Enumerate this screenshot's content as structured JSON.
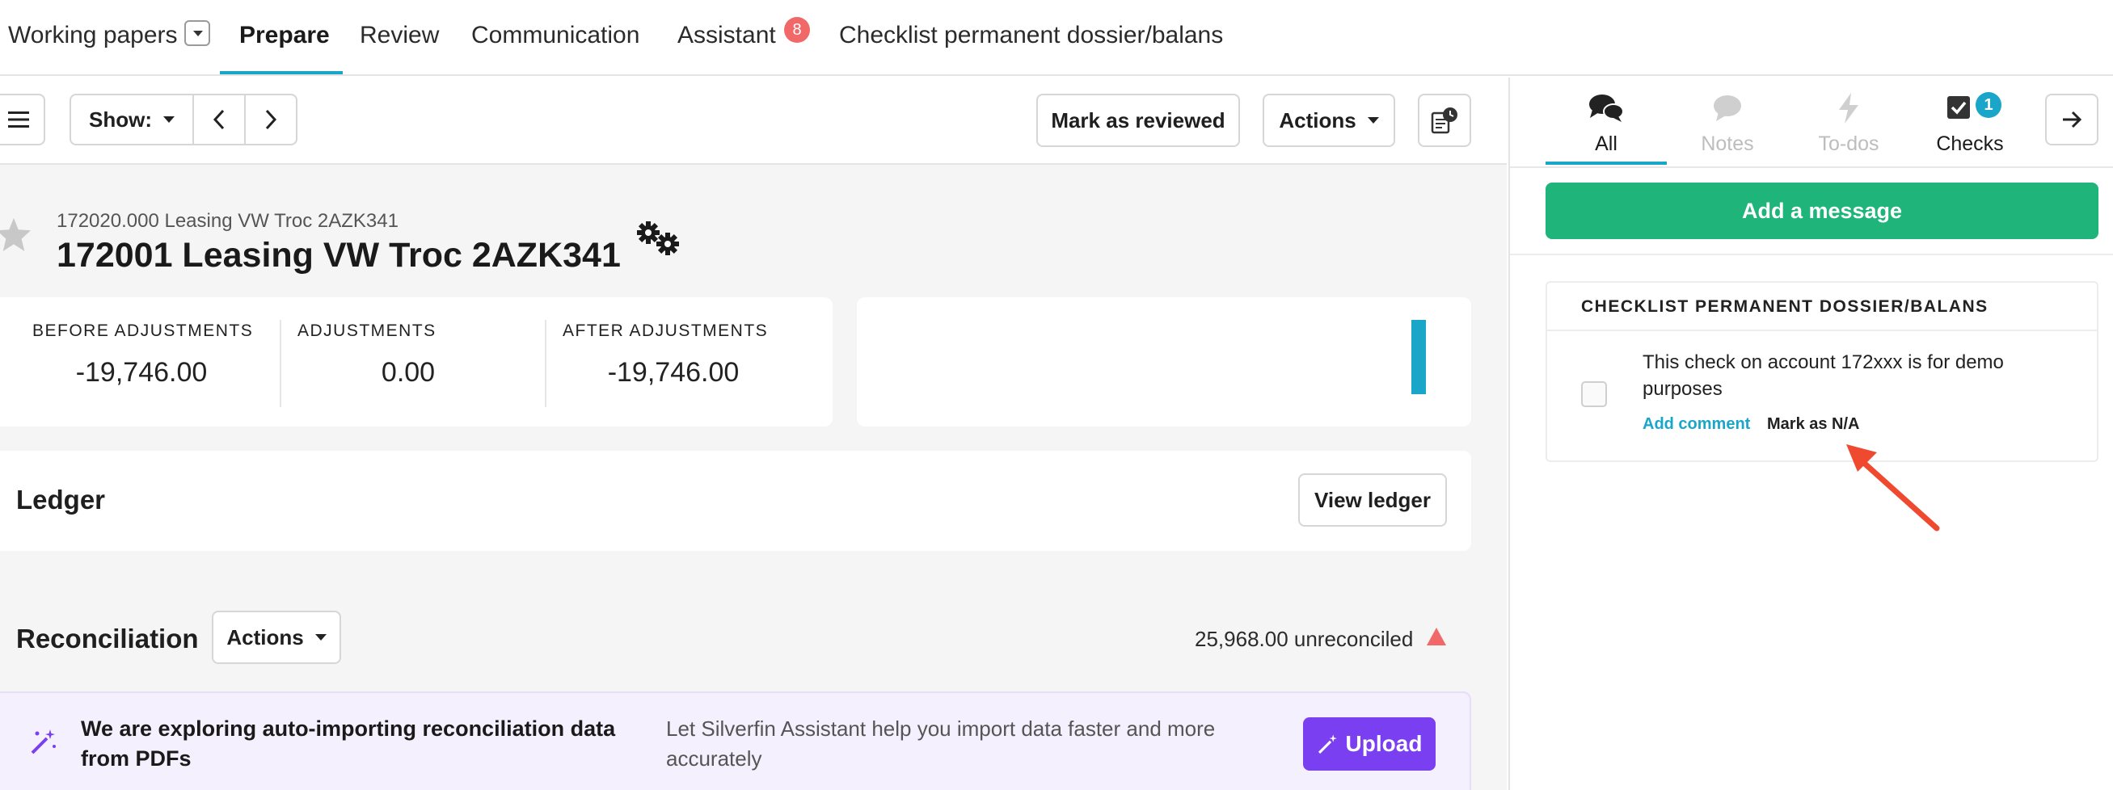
{
  "topnav": {
    "tabs": [
      {
        "label": "Working papers"
      },
      {
        "label": "Prepare"
      },
      {
        "label": "Review"
      },
      {
        "label": "Communication"
      },
      {
        "label": "Assistant",
        "badge": "8"
      },
      {
        "label": "Checklist permanent dossier/balans"
      }
    ],
    "active_tab": "Prepare"
  },
  "toolbar": {
    "menu_icon": "hamburger-icon",
    "show_label": "Show:",
    "mark_reviewed_label": "Mark as reviewed",
    "actions_label": "Actions",
    "history_icon": "document-clock-icon"
  },
  "account": {
    "parent": "172020.000 Leasing VW Troc 2AZK341",
    "title": "172001 Leasing VW Troc 2AZK341"
  },
  "stats": {
    "before_label": "BEFORE ADJUSTMENTS",
    "before_value": "-19,746.00",
    "adjust_label": "ADJUSTMENTS",
    "adjust_value": "0.00",
    "after_label": "AFTER ADJUSTMENTS",
    "after_value": "-19,746.00"
  },
  "ledger": {
    "title": "Ledger",
    "view_label": "View ledger"
  },
  "reconciliation": {
    "title": "Reconciliation",
    "actions_label": "Actions",
    "status": "25,968.00 unreconciled"
  },
  "banner": {
    "text": "We are exploring auto-importing reconciliation data from PDFs",
    "subtext": "Let Silverfin Assistant help you import data faster and more accurately",
    "upload_label": "Upload"
  },
  "right_panel": {
    "tabs": [
      {
        "label": "All"
      },
      {
        "label": "Notes"
      },
      {
        "label": "To-dos"
      },
      {
        "label": "Checks",
        "badge": "1"
      }
    ],
    "add_message_label": "Add a message",
    "checklist": {
      "title": "CHECKLIST PERMANENT DOSSIER/BALANS",
      "item_text": "This check on account 172xxx is for demo purposes",
      "add_comment_label": "Add comment",
      "mark_na_label": "Mark as N/A"
    }
  },
  "colors": {
    "accent_teal": "#1aa6c8",
    "green": "#1fb57a",
    "purple": "#7a3ff0",
    "red_badge": "#f06868",
    "annotation_arrow": "#ef4a2f"
  }
}
